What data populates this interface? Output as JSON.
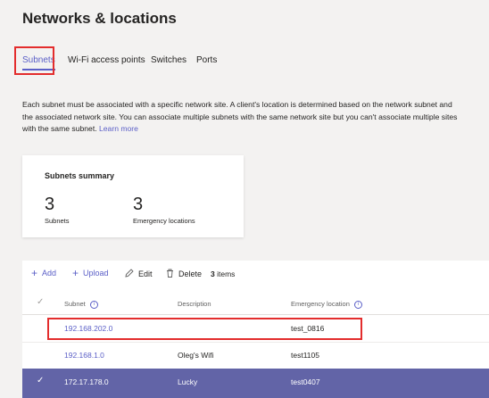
{
  "page": {
    "title": "Networks & locations"
  },
  "tabs": [
    {
      "label": "Subnets",
      "active": true
    },
    {
      "label": "Wi-Fi access points",
      "active": false
    },
    {
      "label": "Switches",
      "active": false
    },
    {
      "label": "Ports",
      "active": false
    }
  ],
  "description": {
    "text": "Each subnet must be associated with a specific network site. A client's location is determined based on the network subnet and the associated network site. You can associate multiple subnets with the same network site but you can't associate multiple sites with the same subnet.",
    "link": "Learn more"
  },
  "summary": {
    "title": "Subnets summary",
    "subnets_count": "3",
    "subnets_label": "Subnets",
    "emergency_count": "3",
    "emergency_label": "Emergency locations"
  },
  "toolbar": {
    "add_label": "Add",
    "upload_label": "Upload",
    "edit_label": "Edit",
    "delete_label": "Delete",
    "items_count": "3",
    "items_suffix": "items"
  },
  "table": {
    "columns": [
      "Subnet",
      "Description",
      "Emergency location"
    ],
    "rows": [
      {
        "subnet": "192.168.202.0",
        "description": "",
        "emergency_location": "test_0816",
        "selected": false
      },
      {
        "subnet": "192.168.1.0",
        "description": "Oleg's Wifi",
        "emergency_location": "test1105",
        "selected": false
      },
      {
        "subnet": "172.17.178.0",
        "description": "Lucky",
        "emergency_location": "test0407",
        "selected": true
      }
    ]
  },
  "colors": {
    "accent": "#5b5fc7",
    "selected_row": "#6264a7",
    "highlight_box": "#e32d2d",
    "background": "#f3f2f1"
  },
  "icons": {
    "add": "plus-icon",
    "upload": "plus-icon",
    "edit": "pencil-icon",
    "delete": "trash-icon",
    "check": "checkmark-icon",
    "info": "info-icon"
  }
}
